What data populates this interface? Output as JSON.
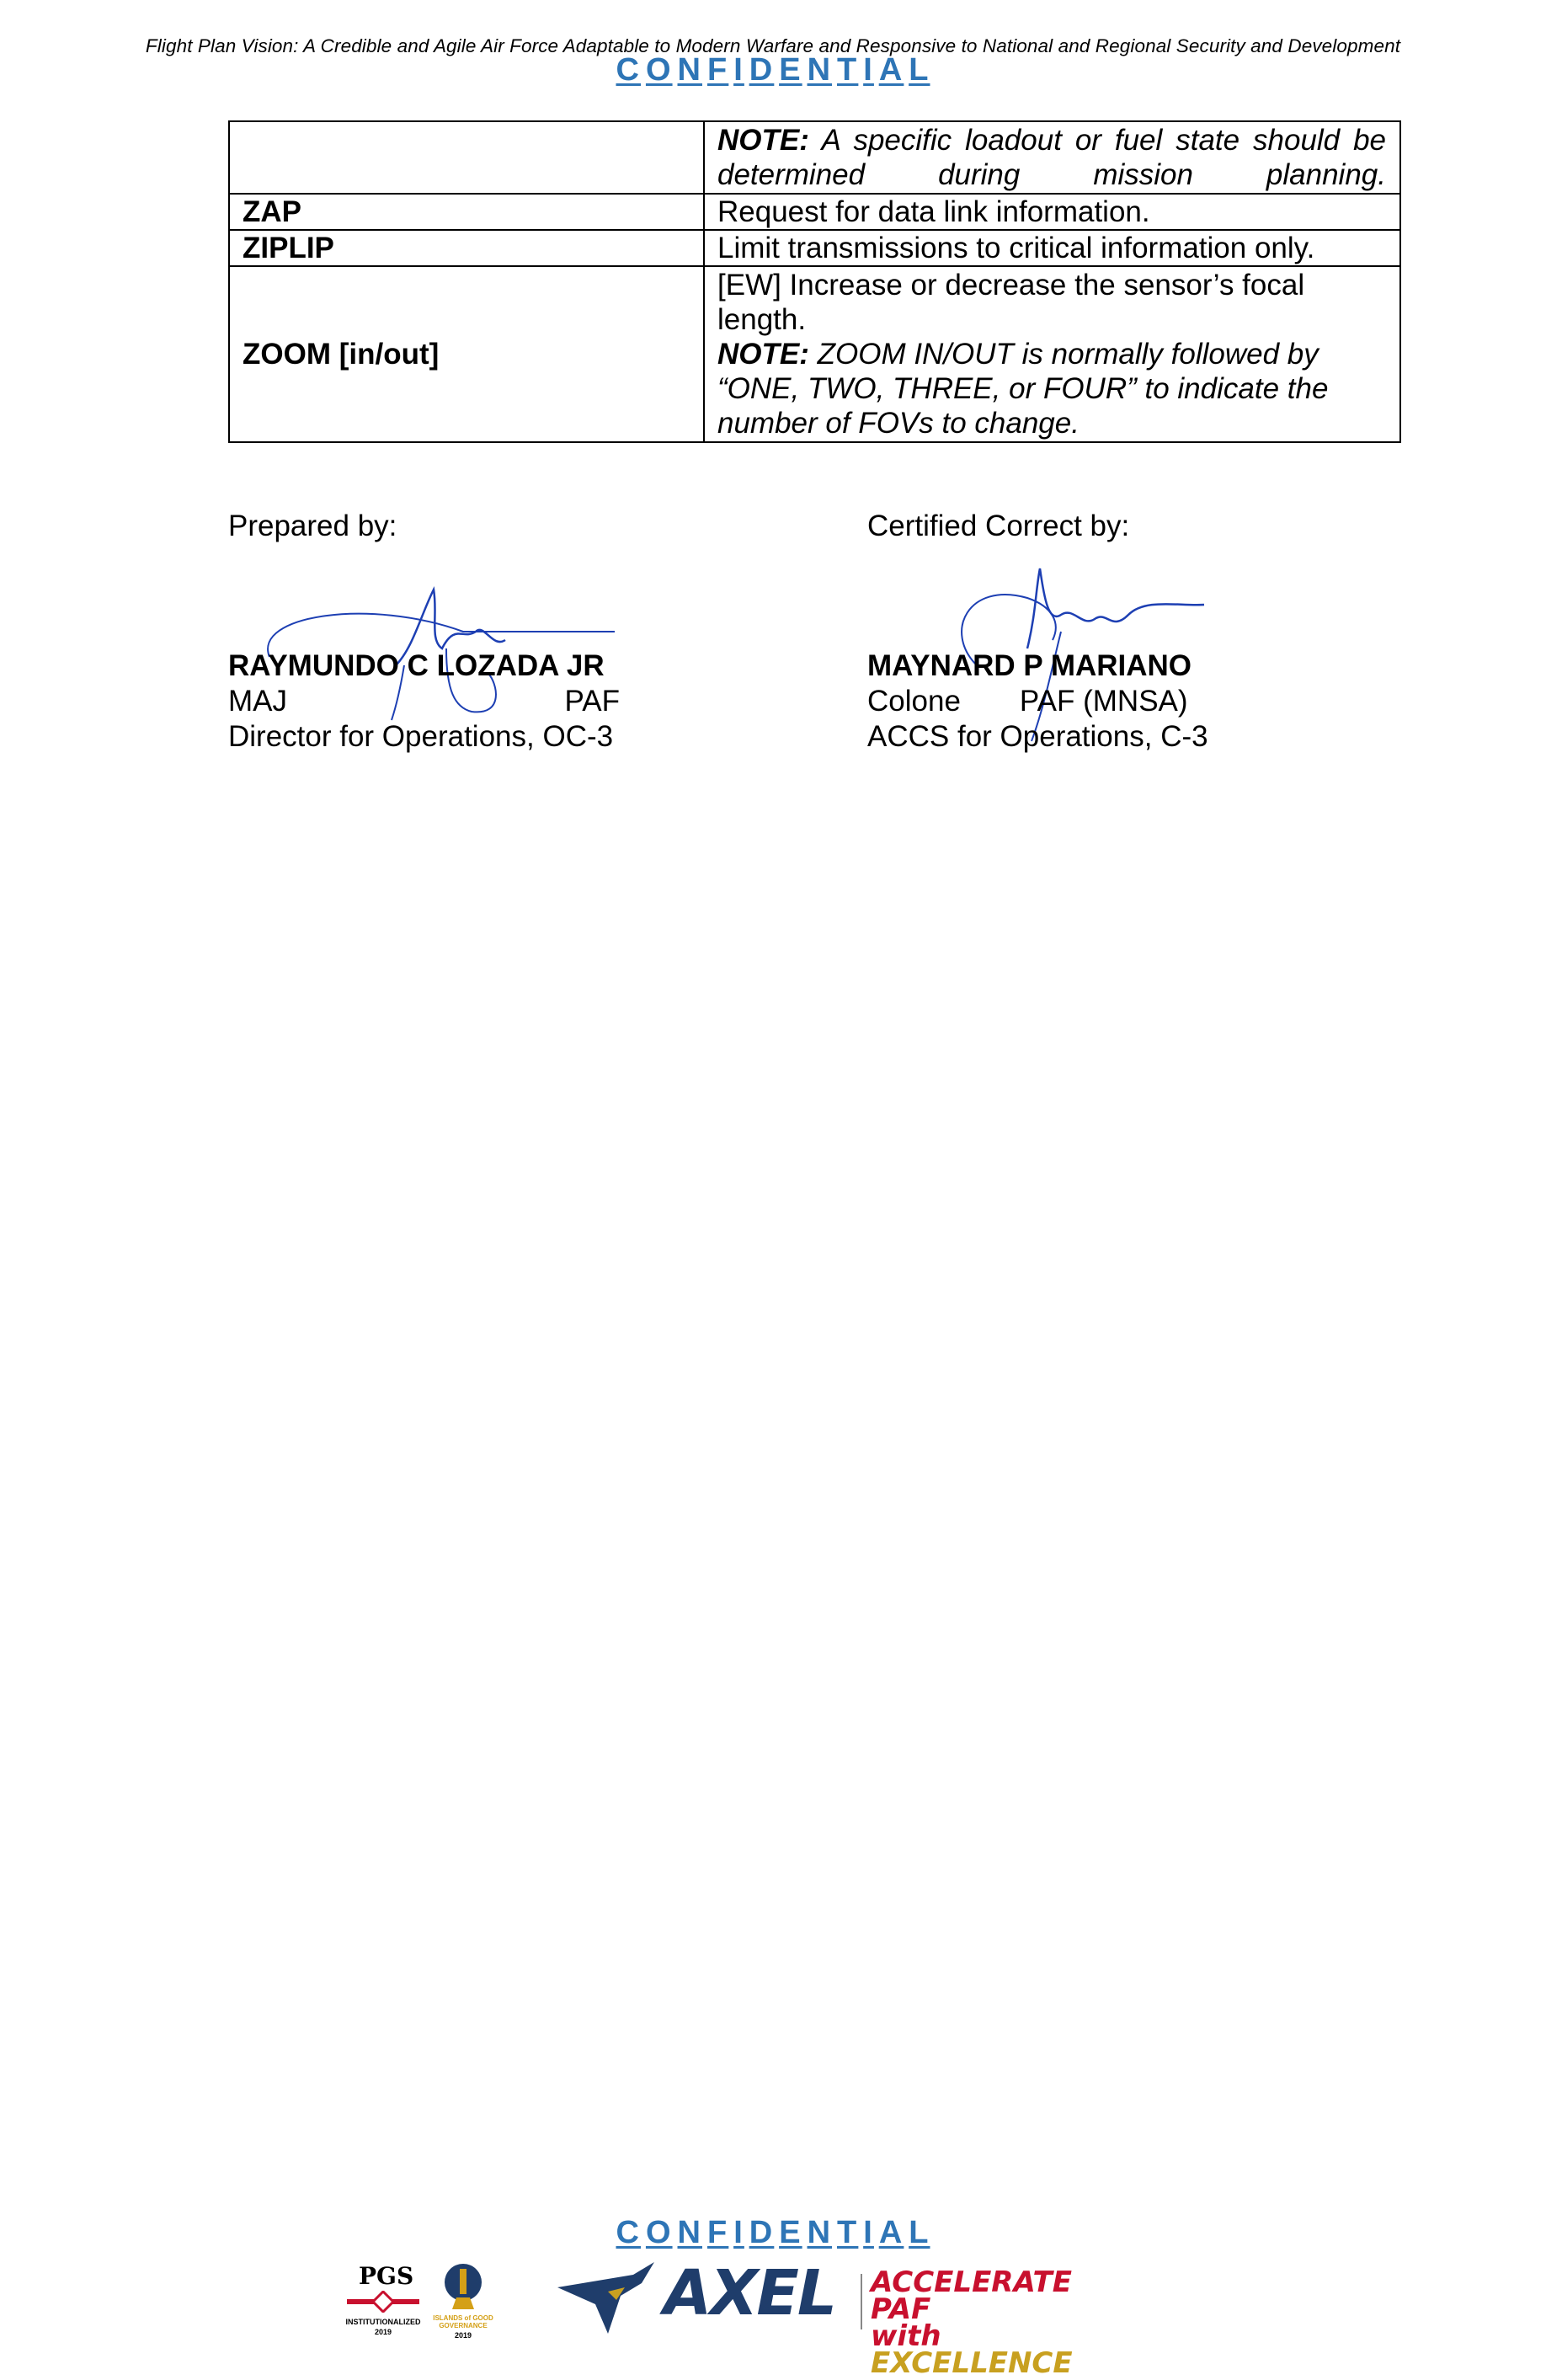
{
  "header": {
    "vision": "Flight Plan Vision: A Credible and Agile Air Force Adaptable to Modern Warfare and Responsive to National and Regional Security and Development",
    "classification": "CONFIDENTIAL"
  },
  "table": {
    "rows": [
      {
        "term": "",
        "note_label": "NOTE:",
        "note_text": " A specific loadout or fuel state should be determined during mission planning."
      },
      {
        "term": "ZAP",
        "definition": "Request for data link information."
      },
      {
        "term": "ZIPLIP",
        "definition": "Limit transmissions to critical information only."
      },
      {
        "term": "ZOOM [in/out]",
        "definition": "[EW] Increase or decrease the sensor’s focal length.",
        "note_label": "NOTE:",
        "note_text": " ZOOM IN/OUT is normally followed by “ONE, TWO, THREE, or FOUR” to indicate the number of FOVs to change."
      }
    ]
  },
  "signatories": {
    "prepared": {
      "label": "Prepared by:",
      "name": "RAYMUNDO C LOZADA JR",
      "rank": "MAJ",
      "service": "PAF",
      "position": "Director for Operations, OC-3"
    },
    "certified": {
      "label": "Certified Correct by:",
      "name": "MAYNARD P MARIANO",
      "rank": "Colone",
      "service": "PAF (MNSA)",
      "position": "ACCS for Operations, C-3"
    }
  },
  "footer": {
    "classification": "CONFIDENTIAL",
    "logos": {
      "pgs": "PGS",
      "pgs_caption": "INSTITUTIONALIZED",
      "pgs_year": "2019",
      "islands_caption": "ISLANDS of GOOD GOVERNANCE",
      "islands_year": "2019",
      "axel": "AXEL",
      "tagline_line1": "ACCELERATE PAF",
      "tagline_with": "with",
      "tagline_excellence": "EXCELLENCE"
    },
    "colors": {
      "classification": "#2e75b6",
      "axel": "#1f3d6b",
      "accent_red": "#c8102e",
      "accent_gold": "#c8a020"
    }
  }
}
